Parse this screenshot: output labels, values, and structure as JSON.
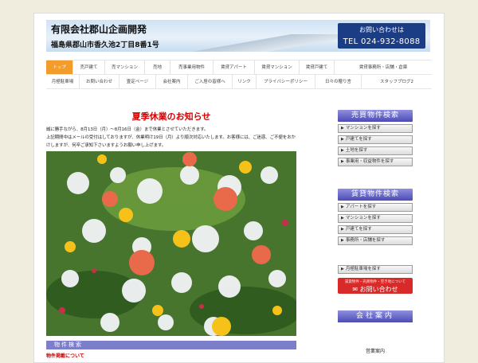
{
  "header": {
    "company_name": "有限会社郡山企画開発",
    "address": "福島県郡山市香久池2丁目8番1号",
    "contact_label": "お問い合わせは",
    "contact_phone": "TEL 024-932-8088"
  },
  "nav": {
    "row1": [
      "トップ",
      "売戸建て",
      "売マンション",
      "売地",
      "売事業用物件",
      "賃貸アパート",
      "賃貸マンション",
      "賃貸戸建て",
      "賃貸事務所・店舗・倉庫"
    ],
    "row2": [
      "月極駐車場",
      "お問い合わせ",
      "査定ページ",
      "会社案内",
      "ご入居の皆様へ",
      "リンク",
      "プライバシーポリシー",
      "日々の贈り言",
      "スタッフブログ2"
    ]
  },
  "post": {
    "title": "夏季休業のお知らせ",
    "line1": "誠に勝手ながら、8月13日（月）～8月16日（金）まで休業とさせていただきます。",
    "line2": "上記期間中はメールの受付はしておりますが、休業明け19日（月）より順次対応いたします。お客様には、ご迷惑、ご不便をおかけしますが、何卒ご承知下さいますようお願い申し上げます。"
  },
  "section_bar": "物件検索",
  "section_sub": "物件掲載について",
  "sidebar": {
    "sale_header": "売買物件検索",
    "sale_items": [
      "マンションを探す",
      "戸建てを探す",
      "土地を探す",
      "事業用・収益物件を探す"
    ],
    "rent_header": "賃貸物件検索",
    "rent_items": [
      "アパートを探す",
      "マンションを探す",
      "戸建てを探す",
      "事務所・店舗を探す"
    ],
    "parking": "月極駐車場を探す",
    "inquiry_small": "賃貸物件・売買物件・空き地について",
    "inquiry_label": "お問い合わせ",
    "company_header": "会社案内",
    "company_caption": "営業案内"
  },
  "colors": {
    "accent_orange": "#f29c2c",
    "nav_blue": "#4c4cb5",
    "alert_red": "#d40000",
    "page_bg": "#f0eddf"
  }
}
